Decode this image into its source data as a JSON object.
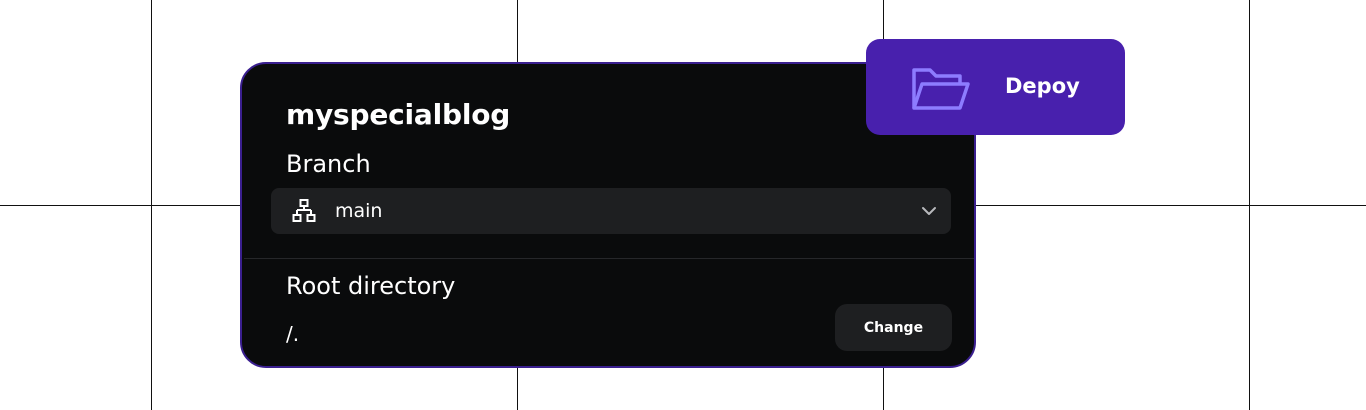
{
  "project": {
    "title": "myspecialblog"
  },
  "branch": {
    "label": "Branch",
    "selected": "main",
    "icon": "branch-hierarchy-icon"
  },
  "root_directory": {
    "label": "Root directory",
    "value": "/.",
    "change_label": "Change"
  },
  "deploy": {
    "label": "Depoy",
    "icon": "folder-open-icon"
  },
  "colors": {
    "card_background": "#0a0b0c",
    "card_border": "#3a1f8f",
    "accent": "#4820ad",
    "folder_icon": "#8d7cff",
    "input_background": "#1e1f21"
  }
}
